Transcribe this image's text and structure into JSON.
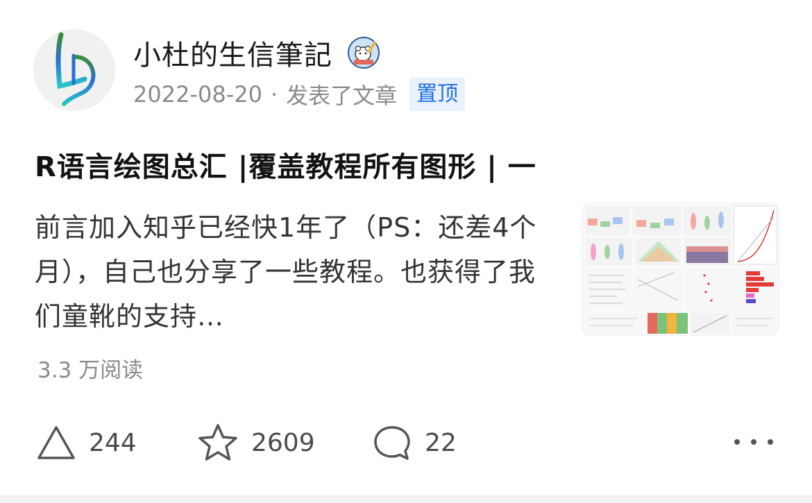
{
  "author": {
    "name": "小杜的生信筆記",
    "avatar_icon": "ld-monogram-logo",
    "badge_icon": "bear-pencil-badge-icon"
  },
  "meta": {
    "date": "2022-08-20",
    "separator": "·",
    "action": "发表了文章",
    "pin_label": "置顶"
  },
  "post": {
    "title": "R语言绘图总汇 |覆盖教程所有图形 | 一",
    "excerpt": "前言加入知乎已经快1年了（PS：还差4个月），自己也分享了一些教程。也获得了我们童靴的支持…",
    "reads": "3.3 万阅读",
    "thumbnail_icon": "chart-collage-thumbnail"
  },
  "actions": {
    "upvote": {
      "icon": "upvote-triangle-icon",
      "count": "244"
    },
    "favorite": {
      "icon": "star-icon",
      "count": "2609"
    },
    "comment": {
      "icon": "comment-bubble-icon",
      "count": "22"
    },
    "more_icon": "more-dots-icon"
  },
  "colors": {
    "accent": "#1f6fe0",
    "pin_bg": "#e9f1fc",
    "muted": "#8a8a8a"
  }
}
